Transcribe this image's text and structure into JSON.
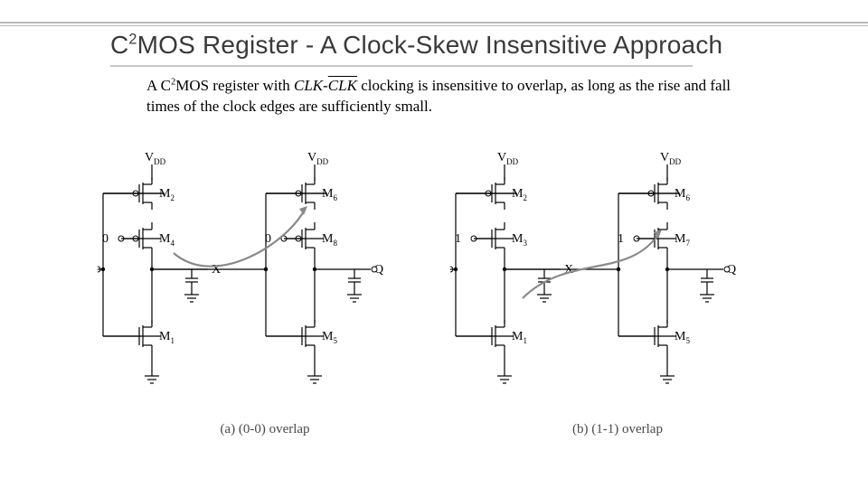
{
  "title_html": "C<sup>2</sup>MOS Register - A Clock-Skew Insensitive Approach",
  "body_html": "A C<sup>2</sup>MOS register with <span class='italic'>CLK-<span class='over'>CLK</span></span> clocking is insensitive to overlap, as long as the rise and fall times of the clock edges are sufficiently small.",
  "fig_a": {
    "caption": "(a) (0-0) overlap",
    "stage1": {
      "vdd": "V_DD",
      "top": "M_2",
      "mid": "M_4",
      "bot": "M_1",
      "mid_in": "0",
      "in": "D",
      "out": "X"
    },
    "stage2": {
      "vdd": "V_DD",
      "top": "M_6",
      "mid": "M_8",
      "bot": "M_5",
      "mid_in": "0",
      "out": "Q"
    }
  },
  "fig_b": {
    "caption": "(b) (1-1) overlap",
    "stage1": {
      "vdd": "V_DD",
      "top": "M_2",
      "mid": "M_3",
      "bot": "M_1",
      "mid_in": "1",
      "in": "D",
      "out": "X"
    },
    "stage2": {
      "vdd": "V_DD",
      "top": "M_6",
      "mid": "M_7",
      "bot": "M_5",
      "mid_in": "1",
      "out": "Q"
    }
  }
}
